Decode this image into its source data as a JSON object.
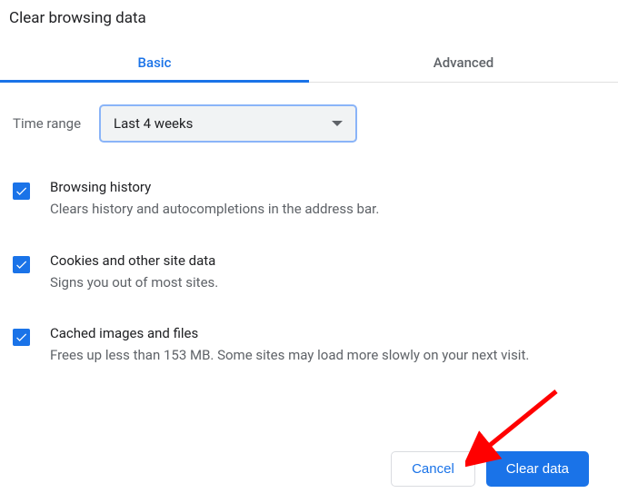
{
  "dialog_title": "Clear browsing data",
  "tabs": {
    "basic": "Basic",
    "advanced": "Advanced"
  },
  "time_range": {
    "label": "Time range",
    "selected": "Last 4 weeks"
  },
  "options": {
    "browsing_history": {
      "title": "Browsing history",
      "description": "Clears history and autocompletions in the address bar."
    },
    "cookies": {
      "title": "Cookies and other site data",
      "description": "Signs you out of most sites."
    },
    "cache": {
      "title": "Cached images and files",
      "description": "Frees up less than 153 MB. Some sites may load more slowly on your next visit."
    }
  },
  "buttons": {
    "cancel": "Cancel",
    "clear": "Clear data"
  }
}
